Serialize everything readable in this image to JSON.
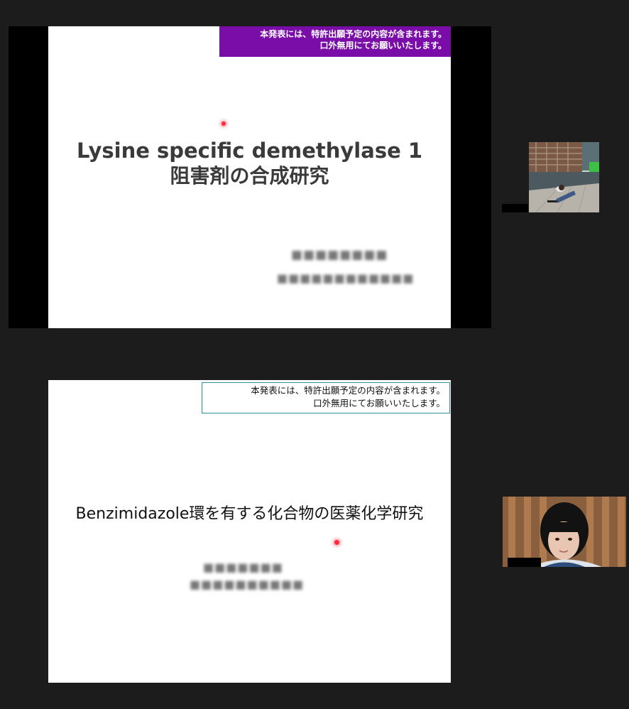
{
  "slide1": {
    "notice_line1": "本発表には、特許出願予定の内容が含まれます。",
    "notice_line2": "口外無用にてお願いいたします。",
    "title_line1": "Lysine specific demethylase 1",
    "title_line2": "阻害剤の合成研究",
    "redacted_line1": "■■■■■■■■",
    "redacted_line2": "■■■■■■■■■■■■"
  },
  "slide2": {
    "notice_line1": "本発表には、特許出願予定の内容が含まれます。",
    "notice_line2": "口外無用にてお願いいたします。",
    "title": "Benzimidazole環を有する化合物の医薬化学研究",
    "redacted_line1": "■■■■■■■",
    "redacted_line2": "■■■■■■■■■■"
  },
  "colors": {
    "notice_purple": "#7a0da8",
    "notice_outline": "#2f8f9a",
    "laser_pointer": "#ff2a3d"
  },
  "icons": {
    "pointer": "laser-pointer-dot"
  }
}
